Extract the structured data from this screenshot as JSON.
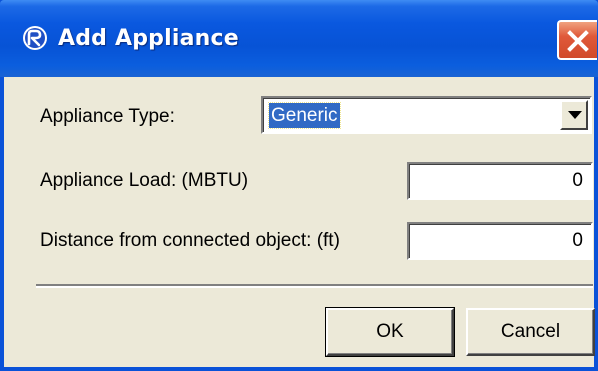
{
  "window": {
    "title": "Add Appliance",
    "close_icon": "close-icon",
    "app_icon": "app-logo-icon"
  },
  "form": {
    "appliance_type": {
      "label": "Appliance Type:",
      "value": "Generic"
    },
    "appliance_load": {
      "label": "Appliance Load: (MBTU)",
      "value": "0"
    },
    "distance": {
      "label": "Distance from connected object: (ft)",
      "value": "0"
    }
  },
  "buttons": {
    "ok_label": "OK",
    "cancel_label": "Cancel"
  },
  "colors": {
    "titlebar": "#0a58df",
    "dialog_bg": "#ece9d8",
    "close_button": "#e0593a",
    "selection": "#316ac5"
  }
}
